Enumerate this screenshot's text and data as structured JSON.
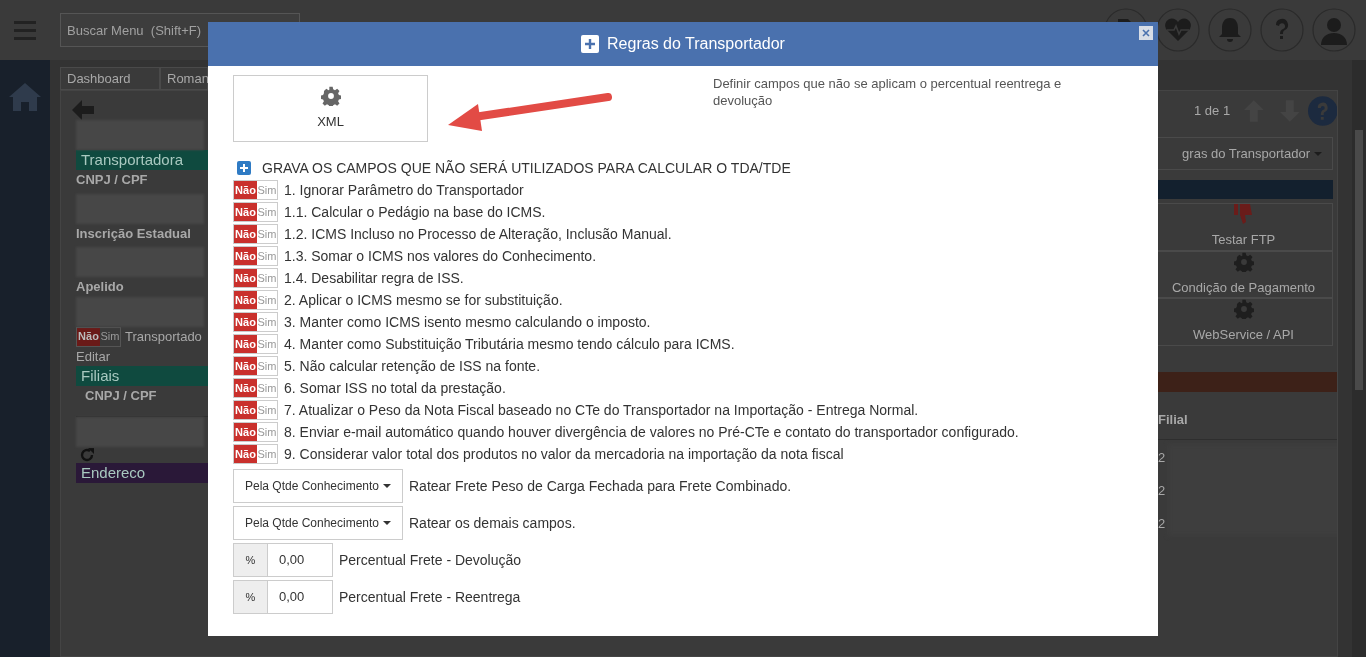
{
  "app": {
    "search": {
      "placeholder": "Buscar Menu  (Shift+F)"
    },
    "tabs": [
      {
        "label": "Dashboard"
      },
      {
        "label": "Roman"
      }
    ],
    "pager": "1 de 1",
    "left_panel": {
      "sections": [
        {
          "kind": "redacted"
        },
        {
          "kind": "bar",
          "label": "Transportadora",
          "color": "#0f4a3f"
        },
        {
          "kind": "label",
          "label": "CNPJ / CPF"
        },
        {
          "kind": "redacted"
        },
        {
          "kind": "label",
          "label": "Inscrição Estadual"
        },
        {
          "kind": "redacted"
        },
        {
          "kind": "label",
          "label": "Apelido"
        },
        {
          "kind": "redacted"
        },
        {
          "kind": "toggle",
          "off_label": "Não",
          "on_label": "Sim",
          "on": false,
          "label": "Transportado"
        },
        {
          "kind": "link",
          "label": "Editar"
        },
        {
          "kind": "bar",
          "label": "Filiais",
          "color": "#0f4a3f"
        },
        {
          "kind": "column",
          "label": "CNPJ / CPF"
        },
        {
          "kind": "redacted"
        },
        {
          "kind": "refresh"
        },
        {
          "kind": "bar",
          "label": "Endereco",
          "color": "#2a1838"
        }
      ]
    },
    "right_panel": {
      "dropdown": "gras do Transportador",
      "actions": [
        {
          "label": "Testar FTP"
        },
        {
          "label": "Condição de Pagamento"
        },
        {
          "label": "WebService / API"
        }
      ],
      "column": "Filial",
      "cells": [
        "2",
        "2",
        "2"
      ]
    }
  },
  "modal": {
    "title": "Regras do Transportador",
    "xml_button": "XML",
    "description": "Definir campos que não se aplicam o percentual reentrega e devolução",
    "section": "GRAVA OS CAMPOS QUE NÃO SERÁ UTILIZADOS PARA CALCULAR O TDA/TDE",
    "rules": [
      {
        "off_label": "Não",
        "on_label": "Sim",
        "on": false,
        "label": "1. Ignorar Parâmetro do Transportador"
      },
      {
        "off_label": "Não",
        "on_label": "Sim",
        "on": false,
        "label": "1.1. Calcular o Pedágio na base do ICMS."
      },
      {
        "off_label": "Não",
        "on_label": "Sim",
        "on": false,
        "label": "1.2. ICMS Incluso no Processo de Alteração, Inclusão Manual."
      },
      {
        "off_label": "Não",
        "on_label": "Sim",
        "on": false,
        "label": "1.3. Somar o ICMS nos valores do Conhecimento."
      },
      {
        "off_label": "Não",
        "on_label": "Sim",
        "on": false,
        "label": "1.4. Desabilitar regra de ISS."
      },
      {
        "off_label": "Não",
        "on_label": "Sim",
        "on": false,
        "label": "2. Aplicar o ICMS mesmo se for substituição."
      },
      {
        "off_label": "Não",
        "on_label": "Sim",
        "on": false,
        "label": "3. Manter como ICMS isento mesmo calculando o imposto."
      },
      {
        "off_label": "Não",
        "on_label": "Sim",
        "on": false,
        "label": "4. Manter como Substituição Tributária mesmo tendo cálculo para ICMS."
      },
      {
        "off_label": "Não",
        "on_label": "Sim",
        "on": false,
        "label": "5. Não calcular retenção de ISS na fonte."
      },
      {
        "off_label": "Não",
        "on_label": "Sim",
        "on": false,
        "label": "6. Somar ISS no total da prestação."
      },
      {
        "off_label": "Não",
        "on_label": "Sim",
        "on": false,
        "label": "7. Atualizar o Peso da Nota Fiscal baseado no CTe do Transportador na Importação - Entrega Normal."
      },
      {
        "off_label": "Não",
        "on_label": "Sim",
        "on": false,
        "label": "8. Enviar e-mail automático quando houver divergência de valores no Pré-CTe e contato do transportador configurado."
      },
      {
        "off_label": "Não",
        "on_label": "Sim",
        "on": false,
        "label": "9. Considerar valor total dos produtos no valor da mercadoria na importação da nota fiscal"
      }
    ],
    "selects": [
      {
        "value": "Pela Qtde Conhecimento",
        "label": "Ratear Frete Peso de Carga Fechada para Frete Combinado."
      },
      {
        "value": "Pela Qtde Conhecimento",
        "label": "Ratear os demais campos."
      }
    ],
    "percent_fields": [
      {
        "prefix": "%",
        "value": "0,00",
        "label": "Percentual Frete - Devolução"
      },
      {
        "prefix": "%",
        "value": "0,00",
        "label": "Percentual Frete - Reentrega"
      }
    ]
  }
}
